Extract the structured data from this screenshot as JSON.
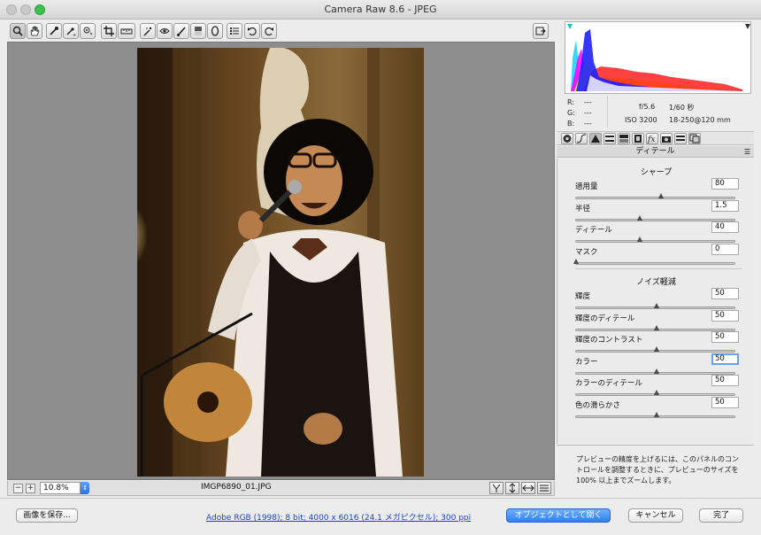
{
  "window": {
    "title": "Camera Raw 8.6  -  JPEG"
  },
  "toolbar": {
    "tools": [
      "zoom-tool",
      "hand-tool",
      "white-balance-tool",
      "color-sampler-tool",
      "target-adjustment-tool",
      "crop-tool",
      "straighten-tool",
      "spot-removal-tool",
      "red-eye-tool",
      "adjustment-brush",
      "graduated-filter",
      "radial-filter",
      "preferences",
      "rotate-ccw",
      "rotate-cw"
    ]
  },
  "preview": {
    "zoom": "10.8%",
    "filename": "IMGP6890_01.JPG"
  },
  "info": {
    "r_label": "R:",
    "r_value": "---",
    "g_label": "G:",
    "g_value": "---",
    "b_label": "B:",
    "b_value": "---",
    "aperture": "f/5.6",
    "shutter": "1/60 秒",
    "iso": "ISO 3200",
    "lens": "18-250@120 mm"
  },
  "panel": {
    "title": "ディテール",
    "sharpen": {
      "title": "シャープ",
      "rows": [
        {
          "label": "適用量",
          "value": "80",
          "pos": 0.53
        },
        {
          "label": "半径",
          "value": "1.5",
          "pos": 0.4
        },
        {
          "label": "ディテール",
          "value": "40",
          "pos": 0.4
        },
        {
          "label": "マスク",
          "value": "0",
          "pos": 0.0
        }
      ]
    },
    "noise": {
      "title": "ノイズ軽減",
      "rows": [
        {
          "label": "輝度",
          "value": "50",
          "pos": 0.5
        },
        {
          "label": "輝度のディテール",
          "value": "50",
          "pos": 0.5
        },
        {
          "label": "輝度のコントラスト",
          "value": "50",
          "pos": 0.5
        },
        {
          "label": "カラー",
          "value": "50",
          "pos": 0.5
        },
        {
          "label": "カラーのディテール",
          "value": "50",
          "pos": 0.5
        },
        {
          "label": "色の滑らかさ",
          "value": "50",
          "pos": 0.5
        }
      ]
    },
    "note": "プレビューの精度を上げるには、このパネルのコントロールを調整するときに、プレビューのサイズを 100% 以上までズームします。"
  },
  "bottom": {
    "save_label": "画像を保存...",
    "workflow_link": "Adobe RGB (1998); 8 bit; 4000 x 6016 (24.1 メガピクセル); 300 ppi",
    "open_label": "オブジェクトとして開く",
    "cancel_label": "キャンセル",
    "done_label": "完了"
  }
}
